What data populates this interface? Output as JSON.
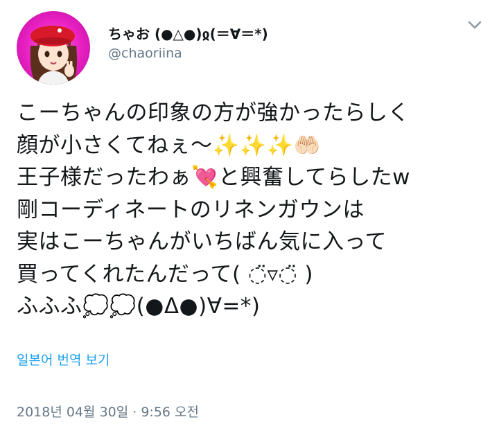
{
  "user": {
    "display_name": "ちゃお (●△●)ჲ(＝∀＝*)",
    "handle": "@chaoriina",
    "avatar_icon": "profile-avatar-icon"
  },
  "menu": {
    "icon": "chevron-down-icon"
  },
  "tweet": {
    "lines": [
      "こーちゃんの印象の方が強かったらしく",
      "顔が小さくてねぇ〜✨✨✨🤲🏻",
      "王子様だったわぁ💘と興奮してらしたw",
      "剛コーディネートのリネンガウンは",
      "実はこーちゃんがいちばん気に入って",
      "買ってくれたんだって( ◌̈▿◌̈ )",
      "ふふふ💭💭(●Δ●)∀=*)"
    ]
  },
  "translate": {
    "label": "일본어 번역 보기"
  },
  "timestamp": "2018년 04월 30일 · 9:56 오전",
  "colors": {
    "link": "#1da1f2",
    "muted": "#657786",
    "text": "#14171a",
    "avatar_bg": "#e81fc2"
  }
}
